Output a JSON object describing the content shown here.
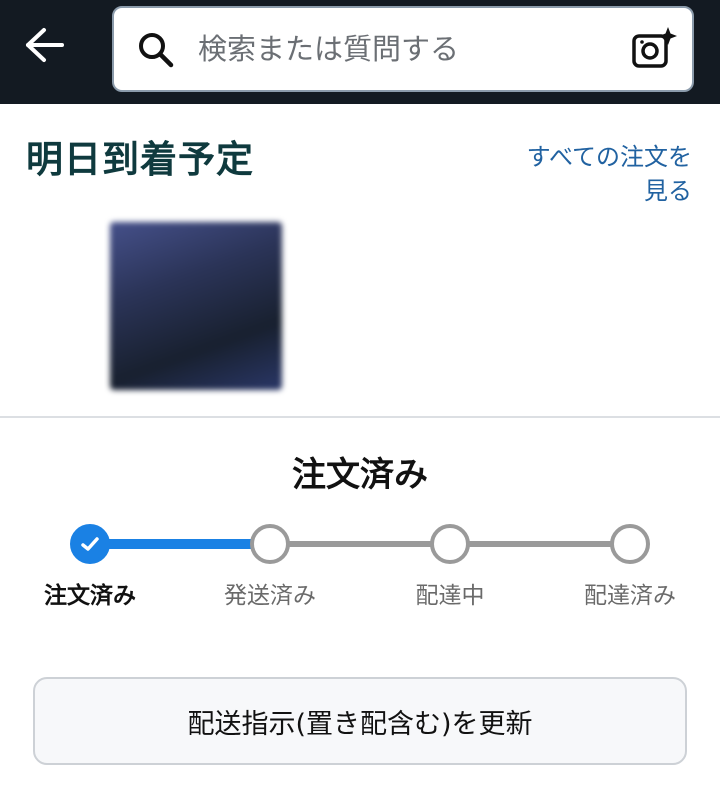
{
  "header": {
    "search_placeholder": "検索または質問する",
    "back_icon": "back-arrow-icon",
    "search_icon": "search-icon",
    "camera_icon": "camera-sparkle-icon"
  },
  "delivery": {
    "title": "明日到着予定",
    "view_all_orders_line1": "すべての注文を",
    "view_all_orders_line2": "見る"
  },
  "status": {
    "heading": "注文済み",
    "steps": [
      {
        "label": "注文済み",
        "state": "done"
      },
      {
        "label": "発送済み",
        "state": "pending"
      },
      {
        "label": "配達中",
        "state": "pending"
      },
      {
        "label": "配達済み",
        "state": "pending"
      }
    ],
    "progress": 0.33
  },
  "actions": {
    "update_delivery_label": "配送指示(置き配含む)を更新"
  },
  "colors": {
    "header_bg": "#131a22",
    "progress_blue": "#1a81e4",
    "link_blue": "#2162a1",
    "title_teal": "#0f3a3e"
  }
}
